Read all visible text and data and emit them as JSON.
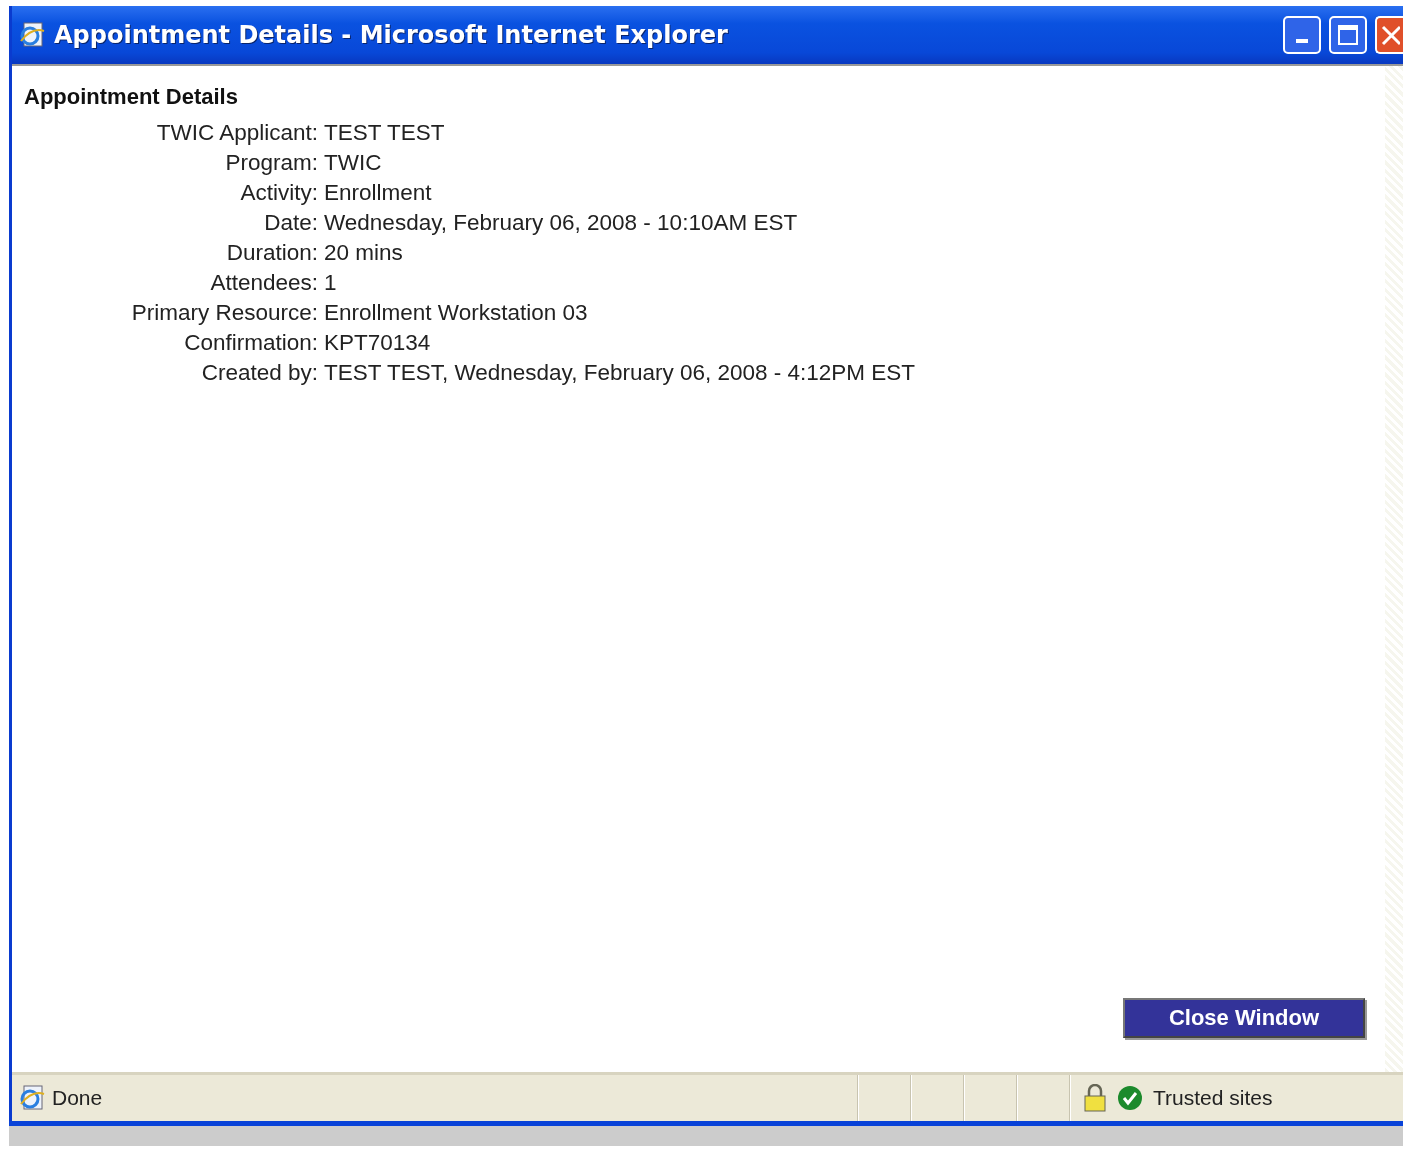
{
  "window": {
    "title": "Appointment Details - Microsoft Internet Explorer"
  },
  "page": {
    "heading": "Appointment Details",
    "fields": [
      {
        "label": "TWIC Applicant:",
        "value": "TEST TEST"
      },
      {
        "label": "Program:",
        "value": "TWIC"
      },
      {
        "label": "Activity:",
        "value": "Enrollment"
      },
      {
        "label": "Date:",
        "value": "Wednesday, February 06, 2008 - 10:10AM EST"
      },
      {
        "label": "Duration:",
        "value": "20 mins"
      },
      {
        "label": "Attendees:",
        "value": "1"
      },
      {
        "label": "Primary Resource:",
        "value": "Enrollment Workstation 03"
      },
      {
        "label": "Confirmation:",
        "value": "KPT70134"
      },
      {
        "label": "Created by:",
        "value": "TEST TEST, Wednesday, February 06, 2008 - 4:12PM EST"
      }
    ],
    "close_button": "Close Window"
  },
  "status_bar": {
    "status": "Done",
    "zone": "Trusted sites"
  }
}
